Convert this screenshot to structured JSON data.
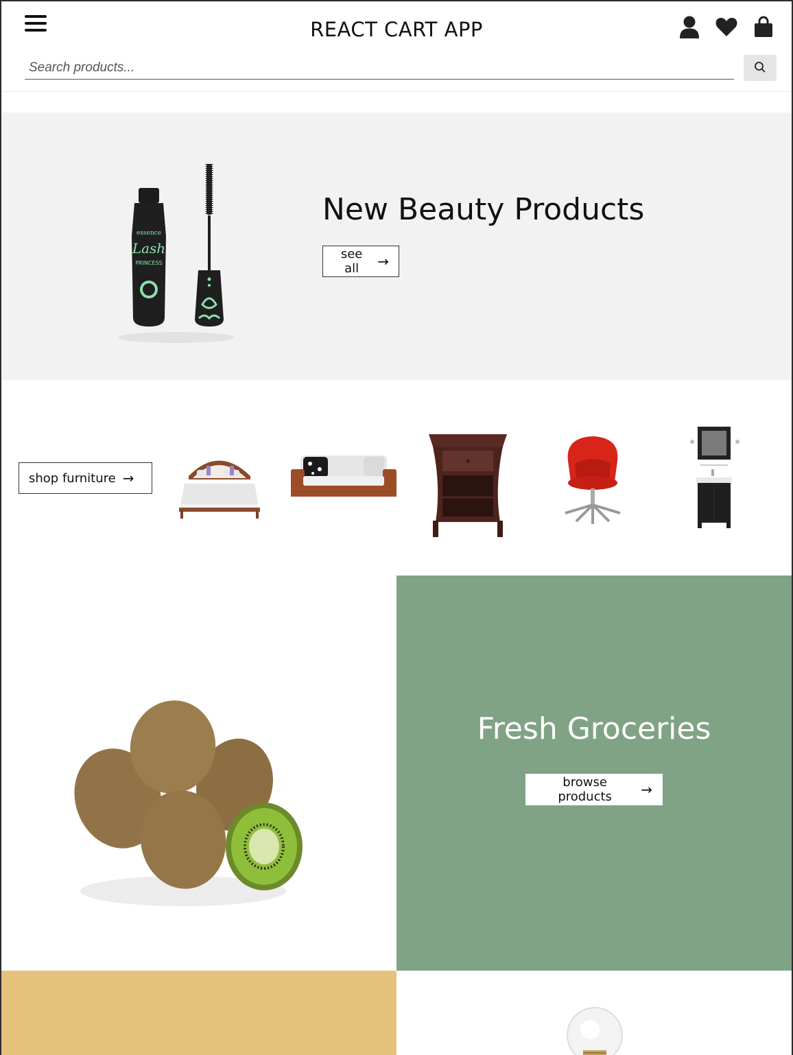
{
  "header": {
    "title": "REACT CART APP",
    "menu_icon": "hamburger-menu-icon",
    "account_icon": "user-icon",
    "wishlist_icon": "heart-icon",
    "cart_icon": "shopping-bag-icon"
  },
  "search": {
    "placeholder": "Search products...",
    "button_icon": "search-icon"
  },
  "hero_beauty": {
    "title": "New Beauty Products",
    "button_label": "see all",
    "button_arrow": "→",
    "background": "#f2f2f2",
    "image": "mascara-product-image"
  },
  "furniture": {
    "button_label": "shop furniture",
    "button_arrow": "→",
    "items": [
      "bed-image",
      "sofa-image",
      "nightstand-image",
      "red-office-chair-image",
      "bathroom-vanity-mirror-image"
    ]
  },
  "groceries": {
    "title": "Fresh Groceries",
    "button_label": "browse products",
    "button_arrow": "→",
    "background": "#80a385",
    "image": "kiwi-fruit-image"
  },
  "bottom": {
    "left_background": "#e5c27c",
    "right_image": "light-bulb-image"
  }
}
